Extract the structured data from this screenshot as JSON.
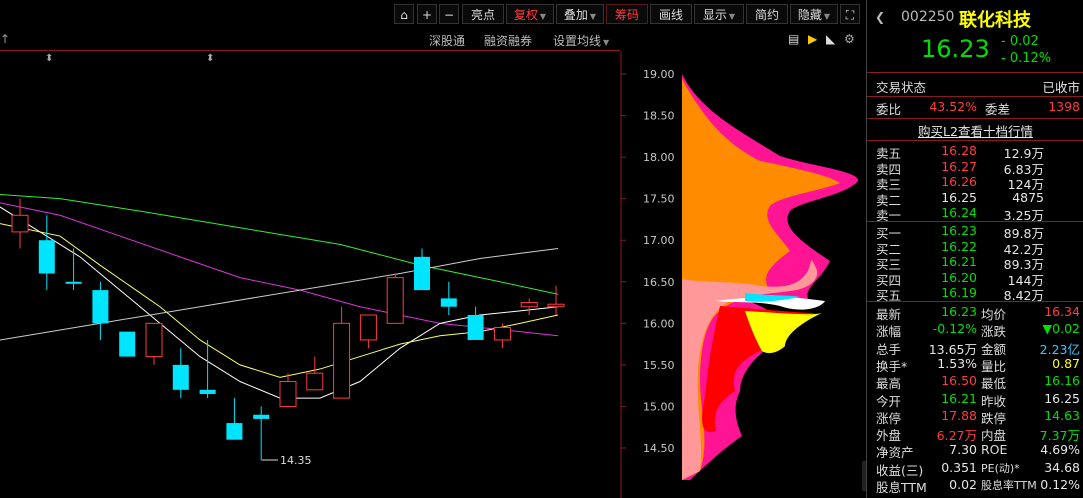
{
  "toolbar": {
    "buttons": [
      "亮点",
      "复权",
      "叠加",
      "筹码",
      "画线",
      "显示",
      "简约",
      "隐藏"
    ],
    "sub": [
      "深股通",
      "融资融券",
      "设置均线"
    ]
  },
  "axis": {
    "ticks": [
      "19.00",
      "18.50",
      "18.00",
      "17.50",
      "17.00",
      "16.50",
      "16.00",
      "15.50",
      "15.00",
      "14.50"
    ]
  },
  "annotation": {
    "low_label": "14.35"
  },
  "stock": {
    "code": "002250",
    "name": "联化科技",
    "price": "16.23",
    "change": "- 0.02",
    "change_pct": "- 0.12%"
  },
  "status": {
    "label": "交易状态",
    "value": "已收市"
  },
  "ratio": {
    "label1": "委比",
    "val1": "43.52%",
    "label2": "委差",
    "val2": "1398"
  },
  "l2_link": "购买L2查看十档行情",
  "asks": [
    {
      "label": "卖五",
      "price": "16.28",
      "vol": "12.9万"
    },
    {
      "label": "卖四",
      "price": "16.27",
      "vol": "6.83万"
    },
    {
      "label": "卖三",
      "price": "16.26",
      "vol": "124万"
    },
    {
      "label": "卖二",
      "price": "16.25",
      "vol": "4875"
    },
    {
      "label": "卖一",
      "price": "16.24",
      "vol": "3.25万"
    }
  ],
  "bids": [
    {
      "label": "买一",
      "price": "16.23",
      "vol": "89.8万"
    },
    {
      "label": "买二",
      "price": "16.22",
      "vol": "42.2万"
    },
    {
      "label": "买三",
      "price": "16.21",
      "vol": "89.3万"
    },
    {
      "label": "买四",
      "price": "16.20",
      "vol": "144万"
    },
    {
      "label": "买五",
      "price": "16.19",
      "vol": "8.42万"
    }
  ],
  "stats": [
    {
      "l1": "最新",
      "v1": "16.23",
      "c1": "grn",
      "l2": "均价",
      "v2": "16.34",
      "c2": "red"
    },
    {
      "l1": "涨幅",
      "v1": "-0.12%",
      "c1": "grn",
      "l2": "涨跌",
      "v2": "▼0.02",
      "c2": "grn"
    },
    {
      "l1": "总手",
      "v1": "13.65万",
      "c1": "wht",
      "l2": "金额",
      "v2": "2.23亿",
      "c2": "cyan"
    },
    {
      "l1": "换手*",
      "v1": "1.53%",
      "c1": "wht",
      "l2": "量比",
      "v2": "0.87",
      "c2": "yel"
    },
    {
      "l1": "最高",
      "v1": "16.50",
      "c1": "red",
      "l2": "最低",
      "v2": "16.16",
      "c2": "grn"
    },
    {
      "l1": "今开",
      "v1": "16.21",
      "c1": "grn",
      "l2": "昨收",
      "v2": "16.25",
      "c2": "wht"
    },
    {
      "l1": "涨停",
      "v1": "17.88",
      "c1": "red",
      "l2": "跌停",
      "v2": "14.63",
      "c2": "grn"
    },
    {
      "l1": "外盘",
      "v1": "6.27万",
      "c1": "red",
      "l2": "内盘",
      "v2": "7.37万",
      "c2": "grn"
    },
    {
      "l1": "净资产",
      "v1": "7.30",
      "c1": "wht",
      "l2": "ROE",
      "v2": "4.69%",
      "c2": "wht"
    },
    {
      "l1": "收益(三)",
      "v1": "0.351",
      "c1": "wht",
      "l2": "PE(动)*",
      "v2": "34.68",
      "c2": "wht"
    },
    {
      "l1": "股息TTM",
      "v1": "0.02",
      "c1": "wht",
      "l2": "股息率TTM",
      "v2": "0.12%",
      "c2": "wht"
    }
  ],
  "chart_data": {
    "type": "candlestick",
    "ylim": [
      14.3,
      19.1
    ],
    "candles": [
      {
        "o": 17.1,
        "h": 17.5,
        "l": 16.9,
        "c": 17.3,
        "up": true
      },
      {
        "o": 17.0,
        "h": 17.3,
        "l": 16.4,
        "c": 16.6,
        "up": false
      },
      {
        "o": 16.5,
        "h": 16.9,
        "l": 16.4,
        "c": 16.5,
        "up": false
      },
      {
        "o": 16.4,
        "h": 16.5,
        "l": 15.8,
        "c": 16.0,
        "up": false
      },
      {
        "o": 15.9,
        "h": 15.9,
        "l": 15.6,
        "c": 15.6,
        "up": false
      },
      {
        "o": 15.6,
        "h": 16.0,
        "l": 15.5,
        "c": 16.0,
        "up": true
      },
      {
        "o": 15.5,
        "h": 15.7,
        "l": 15.1,
        "c": 15.2,
        "up": false
      },
      {
        "o": 15.2,
        "h": 15.8,
        "l": 15.1,
        "c": 15.15,
        "up": false
      },
      {
        "o": 14.8,
        "h": 15.1,
        "l": 14.6,
        "c": 14.6,
        "up": false
      },
      {
        "o": 14.9,
        "h": 15.0,
        "l": 14.35,
        "c": 14.85,
        "up": false
      },
      {
        "o": 15.0,
        "h": 15.4,
        "l": 15.0,
        "c": 15.3,
        "up": true
      },
      {
        "o": 15.2,
        "h": 15.6,
        "l": 15.2,
        "c": 15.4,
        "up": true
      },
      {
        "o": 15.1,
        "h": 16.2,
        "l": 15.1,
        "c": 16.0,
        "up": true
      },
      {
        "o": 15.8,
        "h": 16.1,
        "l": 15.7,
        "c": 16.1,
        "up": true
      },
      {
        "o": 16.0,
        "h": 16.6,
        "l": 16.0,
        "c": 16.55,
        "up": true
      },
      {
        "o": 16.8,
        "h": 16.9,
        "l": 16.4,
        "c": 16.4,
        "up": false
      },
      {
        "o": 16.3,
        "h": 16.5,
        "l": 16.1,
        "c": 16.2,
        "up": false
      },
      {
        "o": 16.1,
        "h": 16.2,
        "l": 15.8,
        "c": 15.8,
        "up": false
      },
      {
        "o": 15.8,
        "h": 16.0,
        "l": 15.7,
        "c": 15.95,
        "up": true
      },
      {
        "o": 16.2,
        "h": 16.3,
        "l": 16.1,
        "c": 16.25,
        "up": true
      },
      {
        "o": 16.2,
        "h": 16.45,
        "l": 16.1,
        "c": 16.23,
        "up": true
      }
    ]
  },
  "colors": {
    "up": "#ff3c3c",
    "down": "#00e5ff",
    "grid": "#8b1a1a"
  }
}
